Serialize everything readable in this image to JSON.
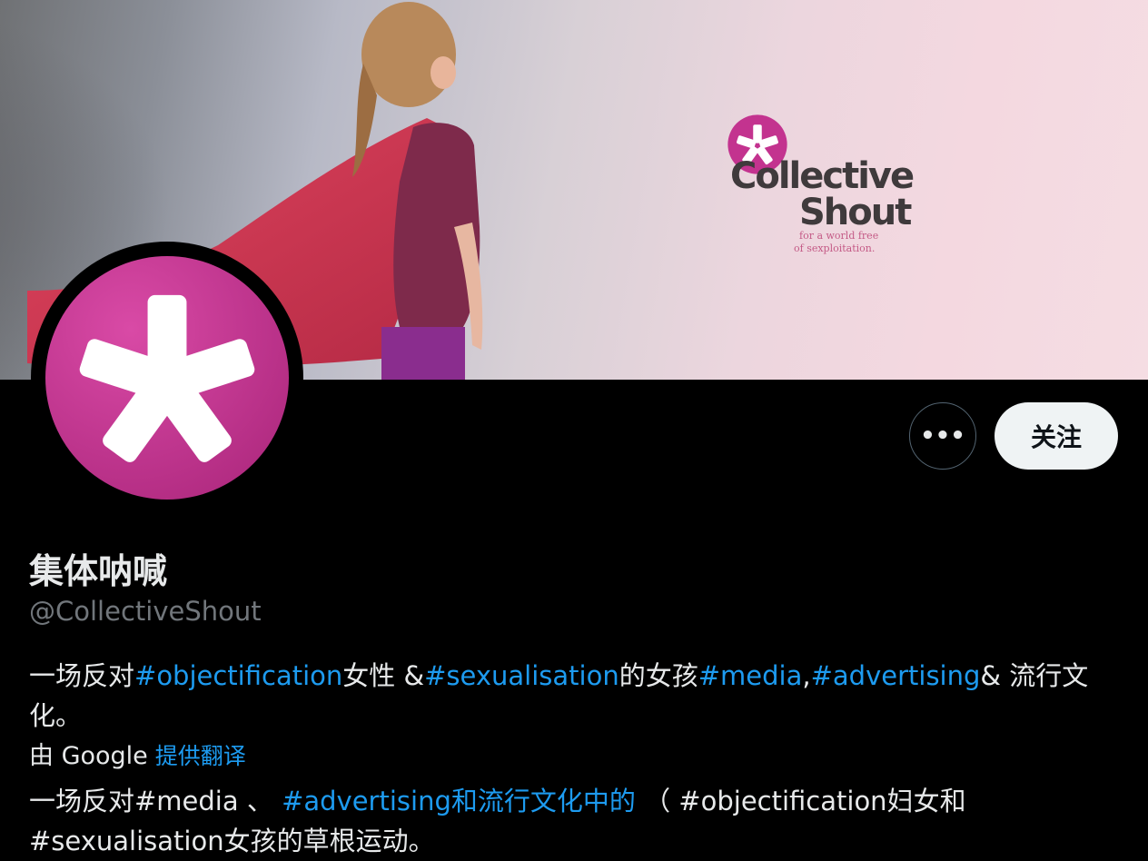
{
  "banner": {
    "logo": {
      "line1": "Collective",
      "line2": "Shout",
      "tagline1": "for a world free",
      "tagline2": "of sexploitation."
    }
  },
  "colors": {
    "brand_magenta": "#c3338f",
    "link_blue": "#1d9bf0",
    "background": "#000000",
    "follow_button_bg": "#eff3f4"
  },
  "actions": {
    "more_icon": "more-horizontal-icon",
    "more_label": "•••",
    "follow_label": "关注"
  },
  "profile": {
    "display_name": "集体呐喊",
    "handle": "@CollectiveShout"
  },
  "bio": {
    "segments": [
      {
        "text": "一场反对",
        "link": false
      },
      {
        "text": "#objectification",
        "link": true
      },
      {
        "text": "女性 &",
        "link": false
      },
      {
        "text": "#sexualisation",
        "link": true
      },
      {
        "text": "的女孩",
        "link": false
      },
      {
        "text": "#media",
        "link": true
      },
      {
        "text": ",",
        "link": false
      },
      {
        "text": "#advertising",
        "link": true
      },
      {
        "text": "& 流行文化。",
        "link": false
      }
    ]
  },
  "translation": {
    "credit": "由 Google",
    "link_label": "提供翻译",
    "segments": [
      {
        "text": "一场反对#media 、 ",
        "link": false
      },
      {
        "text": "#advertising和流行文化中的",
        "link": true
      },
      {
        "text": " （ #objectification妇女和 #sexualisation女孩的草根运动。",
        "link": false
      }
    ]
  }
}
